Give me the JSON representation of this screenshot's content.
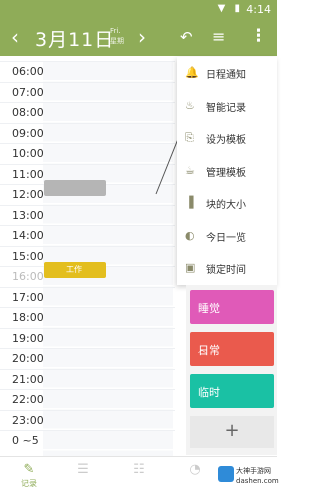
{
  "status_bar": {
    "time": "4:14",
    "icons": "▼ ▮"
  },
  "toolbar": {
    "prev": "‹",
    "date": "3月11日",
    "weekday_top": "Fri.",
    "weekday_bottom": "星期",
    "next": "›",
    "undo": "↶",
    "menu": "≡",
    "more": "⋮"
  },
  "timeline": {
    "hours": [
      "06:00",
      "07:00",
      "08:00",
      "09:00",
      "10:00",
      "11:00",
      "12:00",
      "13:00",
      "14:00",
      "15:00",
      "16:00",
      "17:00",
      "18:00",
      "19:00",
      "20:00",
      "21:00",
      "22:00",
      "23:00",
      "0 ~5"
    ],
    "work_block_label": "工作"
  },
  "dropdown": {
    "items": [
      {
        "icon": "🔔",
        "label": "日程通知"
      },
      {
        "icon": "♨",
        "label": "智能记录"
      },
      {
        "icon": "⎘",
        "label": "设为模板"
      },
      {
        "icon": "☕",
        "label": "管理模板"
      },
      {
        "icon": "▐",
        "label": "块的大小"
      },
      {
        "icon": "◐",
        "label": "今日一览"
      },
      {
        "icon": "▣",
        "label": "锁定时间"
      }
    ]
  },
  "categories": [
    {
      "label": "睡觉",
      "color": "#e05ab8"
    },
    {
      "label": "日常",
      "color": "#ea5a4d"
    },
    {
      "label": "临时",
      "color": "#1ac1a4"
    }
  ],
  "add_label": "+",
  "bottom_nav": [
    {
      "label": "记录",
      "icon": "✎"
    },
    {
      "label": "",
      "icon": "☰"
    },
    {
      "label": "",
      "icon": "☷"
    },
    {
      "label": "",
      "icon": "◔"
    }
  ],
  "watermark": {
    "line1": "大神手游网",
    "line2": "dashen.com"
  }
}
